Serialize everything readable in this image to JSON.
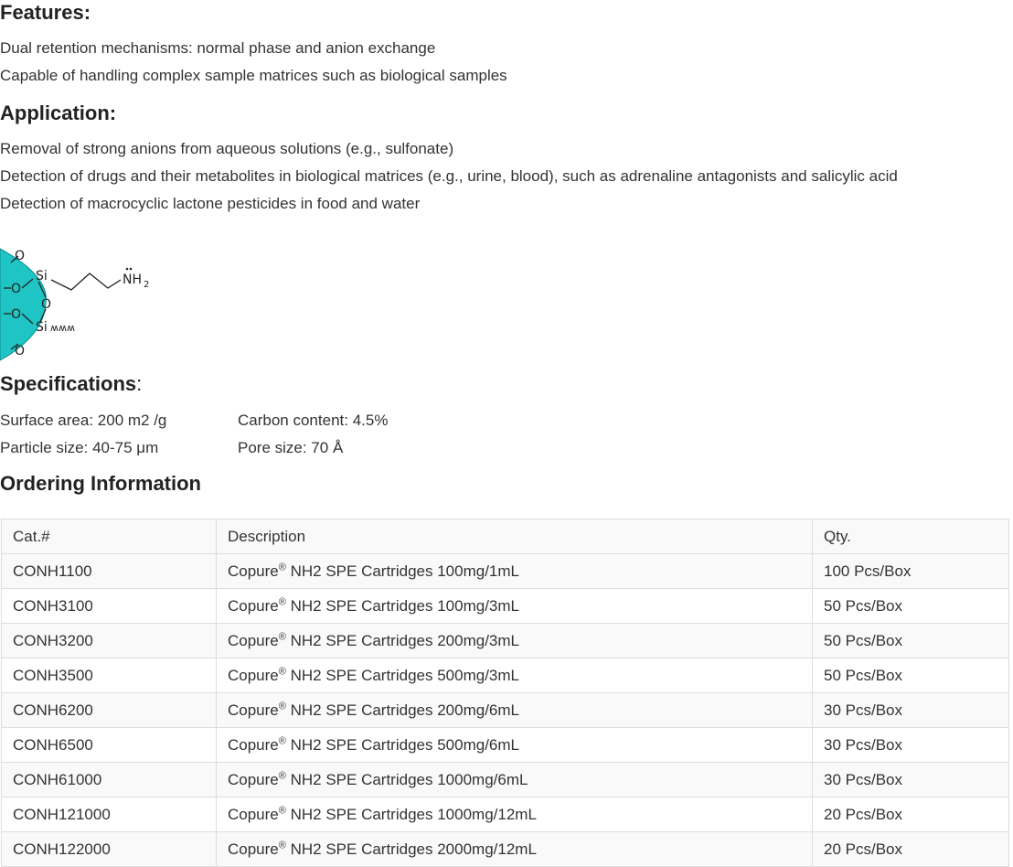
{
  "features": {
    "heading": "Features:",
    "items": [
      "Dual retention mechanisms: normal phase and anion exchange",
      "Capable of handling complex sample matrices such as biological samples"
    ]
  },
  "application": {
    "heading": "Application:",
    "items": [
      "Removal of strong anions from aqueous solutions (e.g., sulfonate)",
      "Detection of drugs and their metabolites in biological matrices (e.g., urine, blood), such as adrenaline antagonists and salicylic acid",
      "Detection of macrocyclic lactone pesticides in food and water"
    ]
  },
  "structure": {
    "si1": "Si",
    "si2": "Si",
    "nh2": "NH",
    "nh2_sub": "2",
    "o": "O",
    "wavy": "ʍʍʍ",
    "particle_color": "#1fc4c4"
  },
  "specifications": {
    "heading": "Specifications",
    "colon": ":",
    "surface_area": "Surface area: 200 m2 /g",
    "carbon_content": "Carbon content: 4.5%",
    "particle_size": "Particle size: 40-75 μm",
    "pore_size": "Pore size: 70 Å"
  },
  "ordering": {
    "heading": "Ordering Information",
    "columns": [
      "Cat.#",
      "Description",
      "Qty."
    ],
    "brand": "Copure",
    "reg": "®",
    "rows": [
      {
        "cat": "CONH1100",
        "desc": " NH2 SPE Cartridges 100mg/1mL",
        "qty": "100 Pcs/Box"
      },
      {
        "cat": "CONH3100",
        "desc": " NH2 SPE Cartridges 100mg/3mL",
        "qty": "50 Pcs/Box"
      },
      {
        "cat": "CONH3200",
        "desc": " NH2 SPE Cartridges 200mg/3mL",
        "qty": "50 Pcs/Box"
      },
      {
        "cat": "CONH3500",
        "desc": " NH2 SPE Cartridges 500mg/3mL",
        "qty": "50 Pcs/Box"
      },
      {
        "cat": "CONH6200",
        "desc": " NH2 SPE Cartridges 200mg/6mL",
        "qty": "30 Pcs/Box"
      },
      {
        "cat": "CONH6500",
        "desc": " NH2 SPE Cartridges 500mg/6mL",
        "qty": "30 Pcs/Box"
      },
      {
        "cat": "CONH61000",
        "desc": " NH2 SPE Cartridges 1000mg/6mL",
        "qty": "30 Pcs/Box"
      },
      {
        "cat": "CONH121000",
        "desc": " NH2 SPE Cartridges 1000mg/12mL",
        "qty": "20 Pcs/Box"
      },
      {
        "cat": "CONH122000",
        "desc": " NH2 SPE Cartridges 2000mg/12mL",
        "qty": "20 Pcs/Box"
      }
    ]
  }
}
